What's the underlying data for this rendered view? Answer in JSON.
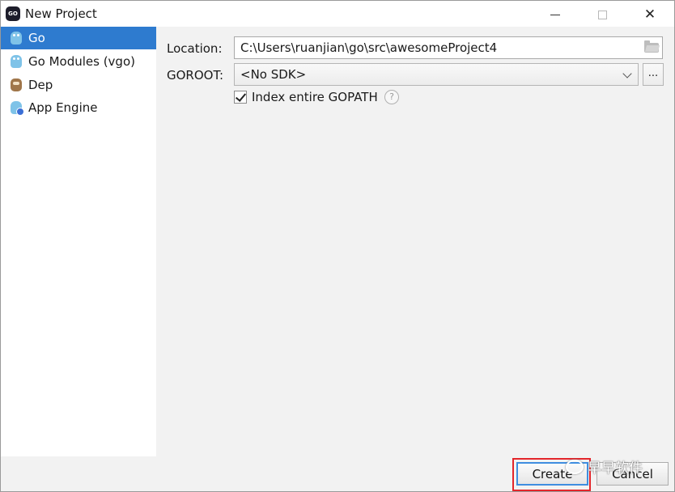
{
  "window": {
    "title": "New Project",
    "app_icon_text": "GO",
    "controls": {
      "minimize": "minimize",
      "maximize": "maximize",
      "close": "✕"
    }
  },
  "sidebar": {
    "items": [
      {
        "label": "Go",
        "icon": "gopher-icon",
        "selected": true
      },
      {
        "label": "Go Modules (vgo)",
        "icon": "gopher-icon",
        "selected": false
      },
      {
        "label": "Dep",
        "icon": "dep-icon",
        "selected": false
      },
      {
        "label": "App Engine",
        "icon": "app-engine-icon",
        "selected": false
      }
    ]
  },
  "form": {
    "location_label": "Location:",
    "location_value": "C:\\Users\\ruanjian\\go\\src\\awesomeProject4",
    "goroot_label": "GOROOT:",
    "goroot_value": "<No SDK>",
    "browse_label": "...",
    "index_gopath_label": "Index entire GOPATH",
    "index_gopath_checked": true,
    "help_glyph": "?"
  },
  "footer": {
    "create_label": "Create",
    "cancel_label": "Cancel",
    "watermark_text": "早早软件"
  },
  "colors": {
    "selection": "#2e7bcf",
    "highlight_box": "#e3262b",
    "default_button_border": "#3f8ee0"
  }
}
